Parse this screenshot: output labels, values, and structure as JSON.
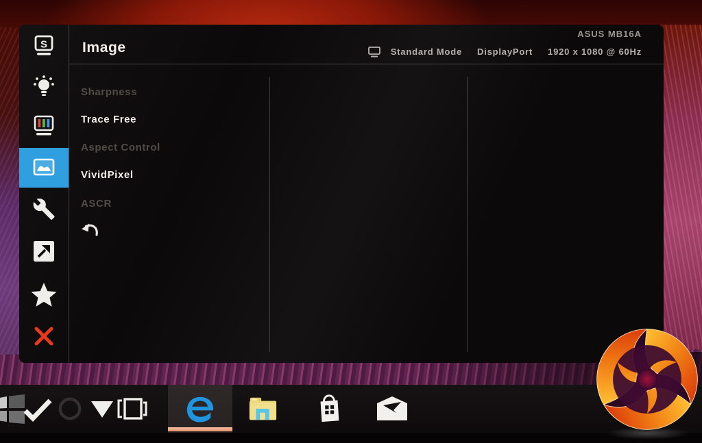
{
  "monitor": {
    "brand_label": "ASUS MB16A",
    "header": {
      "title": "Image",
      "mode": "Standard Mode",
      "input": "DisplayPort",
      "signal": "1920 x 1080 @ 60Hz"
    },
    "menu": [
      {
        "label": "Sharpness",
        "enabled": false
      },
      {
        "label": "Trace Free",
        "enabled": true
      },
      {
        "label": "Aspect Control",
        "enabled": false
      },
      {
        "label": "VividPixel",
        "enabled": true
      },
      {
        "label": "ASCR",
        "enabled": false
      }
    ],
    "sidebar_icons": [
      "splendid",
      "blue-light-filter",
      "color",
      "image",
      "system-setup",
      "shortcut",
      "my-favorite",
      "close"
    ],
    "active_sidebar_item": "image"
  },
  "taskbar": {
    "items": [
      "start",
      "ink-check",
      "cortana-circle",
      "hide-icons-triangle",
      "tablet-mode",
      "edge",
      "file-explorer",
      "store",
      "mail"
    ],
    "active_item": "edge"
  },
  "colors": {
    "active_highlight": "#2f9fe0",
    "close_red": "#e8391d",
    "edge_blue": "#2095dd",
    "edge_underline": "#eda183",
    "folder_yellow": "#ecd97c",
    "folder_tray_blue": "#57c6ea",
    "bar_red": "#d84838",
    "bar_green": "#63b64f",
    "bar_blue": "#4a90dd"
  }
}
